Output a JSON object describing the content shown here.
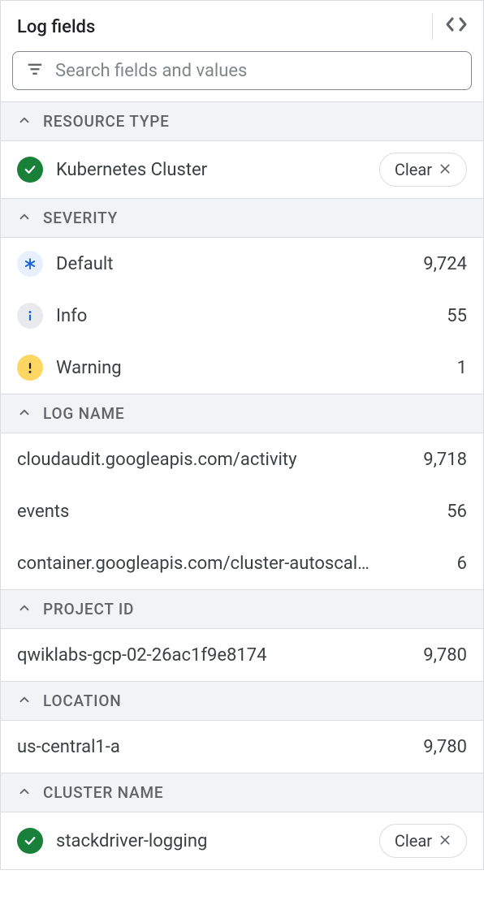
{
  "panel": {
    "title": "Log fields",
    "search": {
      "placeholder": "Search fields and values"
    },
    "clear_label": "Clear"
  },
  "sections": {
    "resource_type": {
      "label": "RESOURCE TYPE",
      "selected": {
        "label": "Kubernetes Cluster"
      }
    },
    "severity": {
      "label": "SEVERITY",
      "items": [
        {
          "label": "Default",
          "count": "9,724"
        },
        {
          "label": "Info",
          "count": "55"
        },
        {
          "label": "Warning",
          "count": "1"
        }
      ]
    },
    "log_name": {
      "label": "LOG NAME",
      "items": [
        {
          "label": "cloudaudit.googleapis.com/activity",
          "count": "9,718"
        },
        {
          "label": "events",
          "count": "56"
        },
        {
          "label": "container.googleapis.com/cluster-autoscal…",
          "count": "6"
        }
      ]
    },
    "project_id": {
      "label": "PROJECT ID",
      "items": [
        {
          "label": "qwiklabs-gcp-02-26ac1f9e8174",
          "count": "9,780"
        }
      ]
    },
    "location": {
      "label": "LOCATION",
      "items": [
        {
          "label": "us-central1-a",
          "count": "9,780"
        }
      ]
    },
    "cluster_name": {
      "label": "CLUSTER NAME",
      "selected": {
        "label": "stackdriver-logging"
      }
    }
  }
}
